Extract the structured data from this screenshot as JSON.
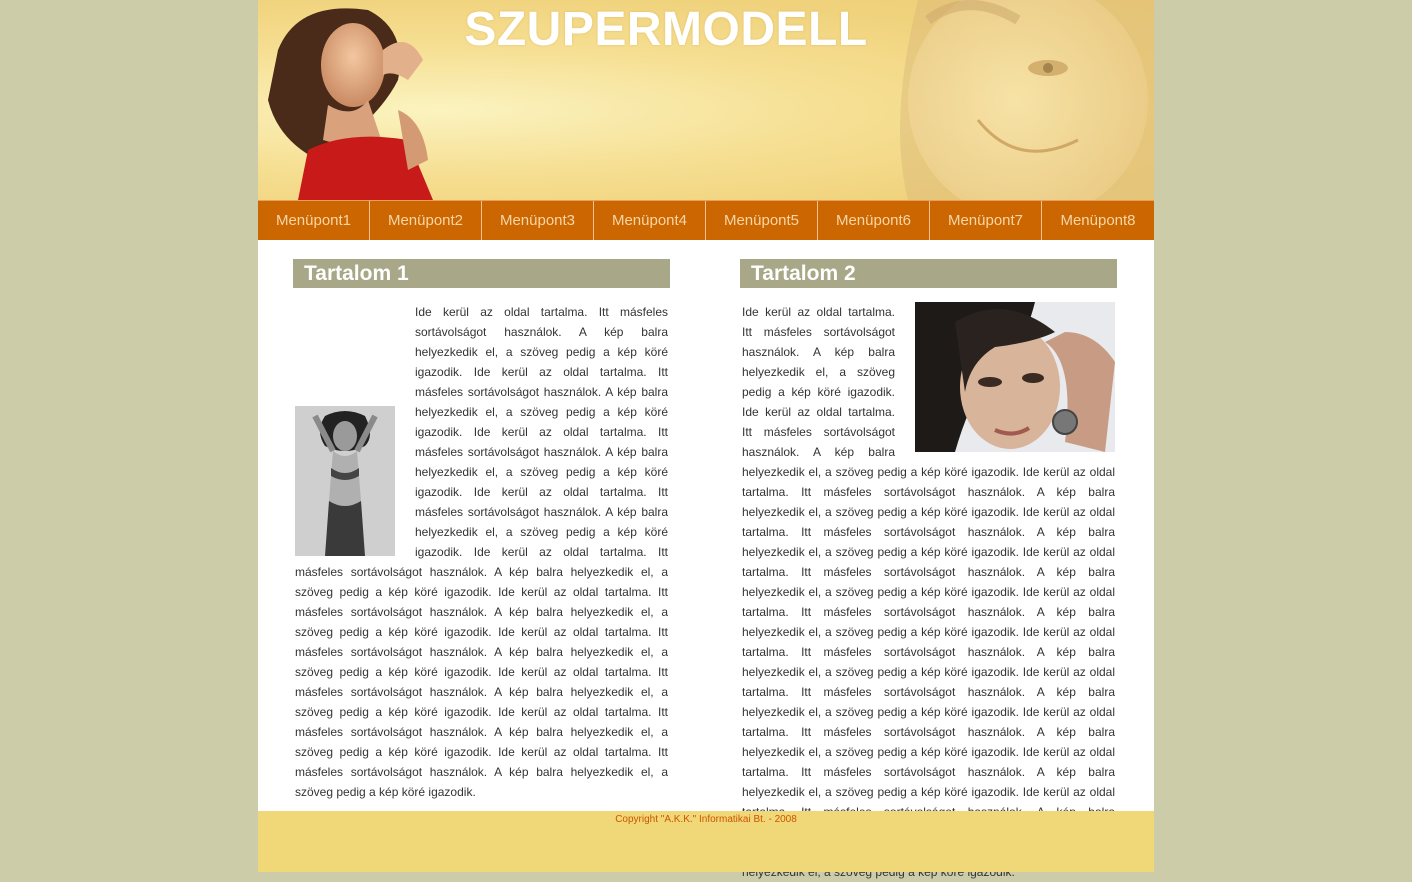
{
  "header": {
    "site_title": "SZUPERMODELL"
  },
  "nav": {
    "items": [
      "Menüpont1",
      "Menüpont2",
      "Menüpont3",
      "Menüpont4",
      "Menüpont5",
      "Menüpont6",
      "Menüpont7",
      "Menüpont8"
    ]
  },
  "content": {
    "col1": {
      "title": "Tartalom 1",
      "text": "Ide kerül az oldal tartalma. Itt másfeles sortávolságot használok. A kép balra helyezkedik el, a szöveg pedig a kép köré igazodik. Ide kerül az oldal tartalma. Itt másfeles sortávolságot használok. A kép balra helyezkedik el, a szöveg pedig a kép köré igazodik. Ide kerül az oldal tartalma. Itt másfeles sortávolságot használok. A kép balra helyezkedik el, a szöveg pedig a kép köré igazodik. Ide kerül az oldal tartalma. Itt másfeles sortávolságot használok. A kép balra helyezkedik el, a szöveg pedig a kép köré igazodik. Ide kerül az oldal tartalma. Itt másfeles sortávolságot használok. A kép balra helyezkedik el, a szöveg pedig a kép köré igazodik. Ide kerül az oldal tartalma. Itt másfeles sortávolságot használok. A kép balra helyezkedik el, a szöveg pedig a kép köré igazodik. Ide kerül az oldal tartalma. Itt másfeles sortávolságot használok. A kép balra helyezkedik el, a szöveg pedig a kép köré igazodik. Ide kerül az oldal tartalma. Itt másfeles sortávolságot használok. A kép balra helyezkedik el, a szöveg pedig a kép köré igazodik. Ide kerül az oldal tartalma. Itt másfeles sortávolságot használok. A kép balra helyezkedik el, a szöveg pedig a kép köré igazodik. Ide kerül az oldal tartalma. Itt másfeles sortávolságot használok. A kép balra helyezkedik el, a szöveg pedig a kép köré igazodik."
    },
    "col2": {
      "title": "Tartalom 2",
      "text": "Ide kerül az oldal tartalma. Itt másfeles sortávolságot használok. A kép balra helyezkedik el, a szöveg pedig a kép köré igazodik. Ide kerül az oldal tartalma. Itt másfeles sortávolságot használok. A kép balra helyezkedik el, a szöveg pedig a kép köré igazodik. Ide kerül az oldal tartalma. Itt másfeles sortávolságot használok. A kép balra helyezkedik el, a szöveg pedig a kép köré igazodik. Ide kerül az oldal tartalma. Itt másfeles sortávolságot használok. A kép balra helyezkedik el, a szöveg pedig a kép köré igazodik. Ide kerül az oldal tartalma. Itt másfeles sortávolságot használok. A kép balra helyezkedik el, a szöveg pedig a kép köré igazodik. Ide kerül az oldal tartalma. Itt másfeles sortávolságot használok. A kép balra helyezkedik el, a szöveg pedig a kép köré igazodik. Ide kerül az oldal tartalma. Itt másfeles sortávolságot használok. A kép balra helyezkedik el, a szöveg pedig a kép köré igazodik. Ide kerül az oldal tartalma. Itt másfeles sortávolságot használok. A kép balra helyezkedik el, a szöveg pedig a kép köré igazodik. Ide kerül az oldal tartalma. Itt másfeles sortávolságot használok. A kép balra helyezkedik el, a szöveg pedig a kép köré igazodik. Ide kerül az oldal tartalma. Itt másfeles sortávolságot használok. A kép balra helyezkedik el, a szöveg pedig a kép köré igazodik. Ide kerül az oldal tartalma. Itt másfeles sortávolságot használok. A kép balra helyezkedik el, a szöveg pedig a kép köré igazodik. Ide kerül az oldal tartalma. Itt másfeles sortávolságot használok. A kép balra helyezkedik el, a szöveg pedig a kép köré igazodik."
    }
  },
  "footer": {
    "copyright": "Copyright \"A.K.K.\" Informatikai Bt. - 2008"
  },
  "colors": {
    "page_background": "#cccca8",
    "nav_background": "#cc6600",
    "nav_text": "#f6d6a6",
    "section_title_background": "#a8a888",
    "footer_background": "#f0d878",
    "footer_text": "#cc5500"
  }
}
